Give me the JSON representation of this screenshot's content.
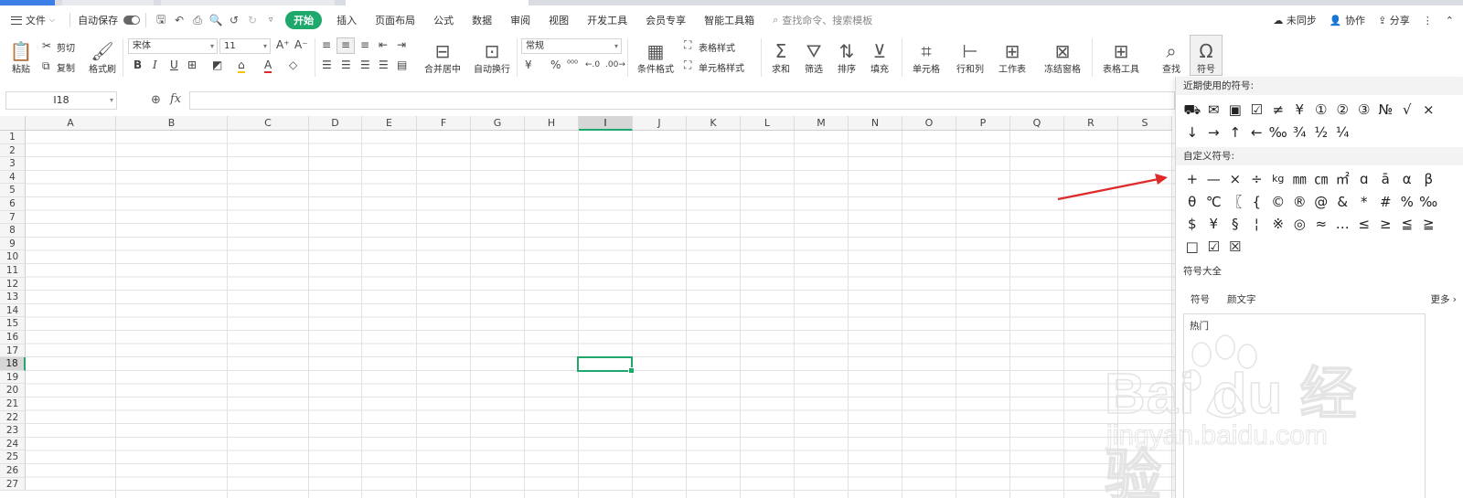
{
  "menu": {
    "file": "文件",
    "autosave": "自动保存",
    "tabs": [
      "开始",
      "插入",
      "页面布局",
      "公式",
      "数据",
      "审阅",
      "视图",
      "开发工具",
      "会员专享",
      "智能工具箱"
    ],
    "active_tab": "开始",
    "search_placeholder": "查找命令、搜索模板",
    "right": {
      "sync": "未同步",
      "collab": "协作",
      "share": "分享"
    }
  },
  "ribbon": {
    "paste": "粘贴",
    "cut": "剪切",
    "copy": "复制",
    "format_painter": "格式刷",
    "font_name": "宋体",
    "font_size": "11",
    "merge_center": "合并居中",
    "wrap_text": "自动换行",
    "number_format": "常规",
    "currency": "¥",
    "percent": "%",
    "conditional_format": "条件格式",
    "table_style": "表格样式",
    "cell_style": "单元格样式",
    "sum": "求和",
    "filter": "筛选",
    "sort": "排序",
    "fill": "填充",
    "cell": "单元格",
    "row_col": "行和列",
    "worksheet": "工作表",
    "freeze": "冻结窗格",
    "table_tools": "表格工具",
    "find": "查找",
    "symbol": "符号"
  },
  "formula_bar": {
    "name_box": "I18",
    "fx": "fx"
  },
  "sheet": {
    "columns": [
      "A",
      "B",
      "C",
      "D",
      "E",
      "F",
      "G",
      "H",
      "I",
      "J",
      "K",
      "L",
      "M",
      "N",
      "O",
      "P",
      "Q",
      "R",
      "S"
    ],
    "rows": [
      "1",
      "2",
      "3",
      "4",
      "5",
      "6",
      "7",
      "8",
      "9",
      "10",
      "11",
      "12",
      "13",
      "14",
      "15",
      "16",
      "17",
      "18",
      "19",
      "20",
      "21",
      "22",
      "23",
      "24",
      "25",
      "26",
      "27"
    ],
    "selected_column": "I",
    "selected_row": "18"
  },
  "symbol_panel": {
    "recent_title": "近期使用的符号:",
    "recent": [
      "⛟",
      "✉",
      "▣",
      "☑",
      "≠",
      "¥",
      "①",
      "②",
      "③",
      "№",
      "√",
      "×",
      "↓",
      "→",
      "↑",
      "←",
      "‰",
      "¾",
      "½",
      "¼"
    ],
    "custom_title": "自定义符号:",
    "custom": [
      "+",
      "—",
      "×",
      "÷",
      "kg",
      "㎜",
      "㎝",
      "㎡",
      "ɑ",
      "ā",
      "α",
      "β",
      "θ",
      "℃",
      "〖",
      "{",
      "©",
      "®",
      "@",
      "&",
      "*",
      "#",
      "%",
      "‰",
      "$",
      "¥",
      "§",
      "¦",
      "※",
      "◎",
      "≈",
      "…",
      "≤",
      "≥",
      "≦",
      "≧",
      "□",
      "☑",
      "☒"
    ],
    "all_title": "符号大全",
    "tabs": [
      "符号",
      "颜文字"
    ],
    "more": "更多",
    "hot": "热门"
  },
  "colors": {
    "accent": "#1ea86b",
    "arrow": "#e02a2a"
  }
}
